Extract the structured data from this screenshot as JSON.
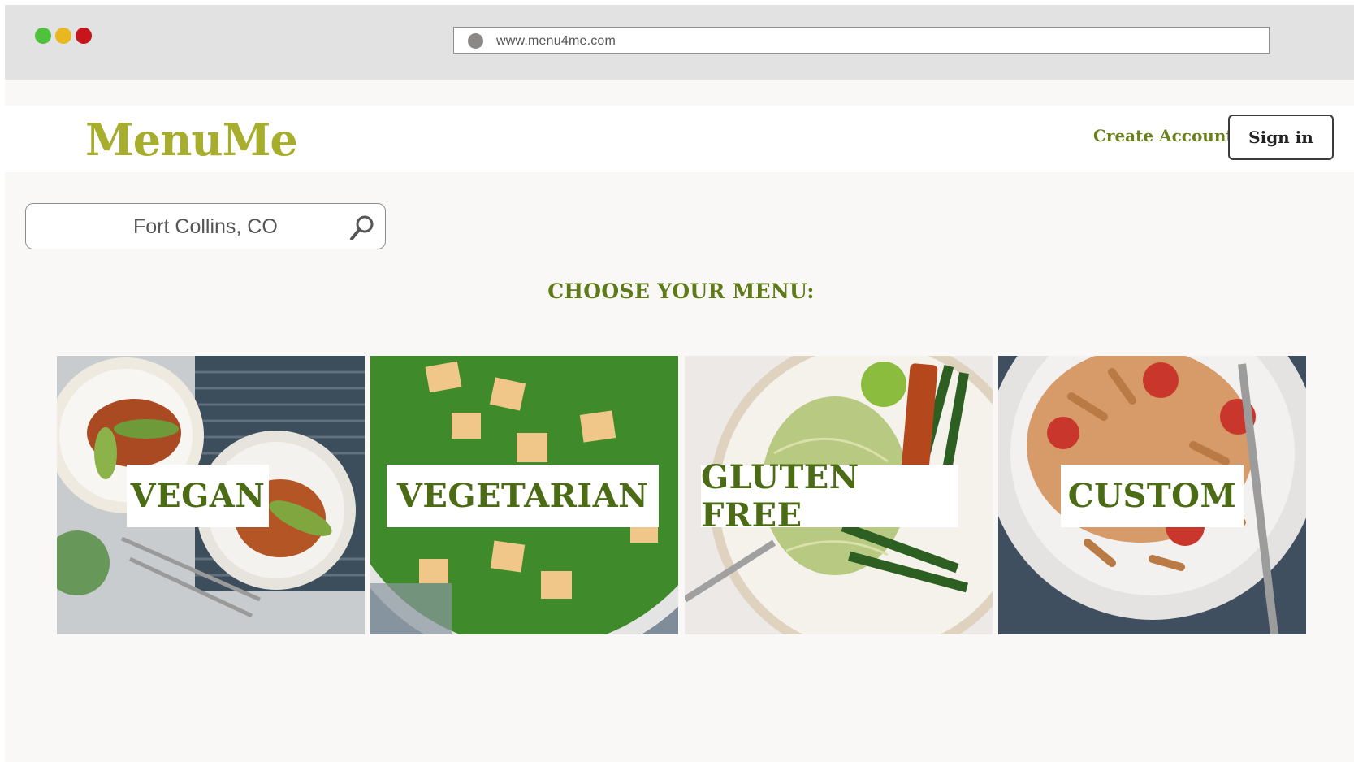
{
  "browser": {
    "url": "www.menu4me.com",
    "traffic_lights": [
      "#4fc13c",
      "#e9b820",
      "#c8141b"
    ]
  },
  "header": {
    "logo": "MenuMe",
    "create_account": "Create Account",
    "sign_in": "Sign in"
  },
  "search": {
    "value": "Fort Collins, CO",
    "icon": "search-icon"
  },
  "main": {
    "heading": "CHOOSE YOUR MENU:",
    "menus": [
      {
        "label": "VEGAN"
      },
      {
        "label": "VEGETARIAN"
      },
      {
        "label": "GLUTEN FREE"
      },
      {
        "label": "CUSTOM"
      }
    ]
  },
  "colors": {
    "brand": "#a7ad2d",
    "accent": "#5f7a18"
  }
}
